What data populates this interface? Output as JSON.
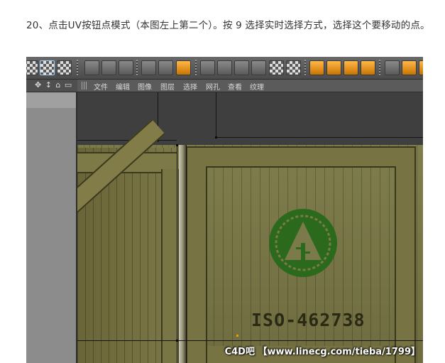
{
  "article": {
    "paragraph": "20、点击UV按钮点模式（本图左上第二个）。按 9 选择实时选择方式，选择这个要移动的点。"
  },
  "toolbar": {
    "icons": [
      "uv-polygon-mode-icon",
      "uv-point-mode-icon",
      "uv-edge-mode-icon",
      "move-tool-icon",
      "scale-tool-icon",
      "rotate-tool-icon",
      "live-selection-icon",
      "rectangle-selection-icon",
      "texture-icon",
      "render-icon",
      "layout-icon"
    ]
  },
  "side": {
    "glyphs": "✥ ↕ ⌂ ▭"
  },
  "menu": {
    "items": [
      "文件",
      "编辑",
      "图像",
      "图层",
      "选择",
      "网孔",
      "查看",
      "纹理"
    ]
  },
  "texture": {
    "stencil": "ISO-462738",
    "watermark": "C4D吧 【www.linecg.com/tieba/1799】"
  }
}
